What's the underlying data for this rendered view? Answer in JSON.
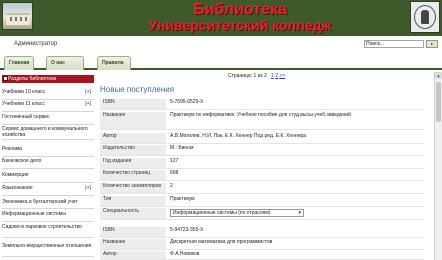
{
  "header": {
    "title_line1": "Библиотека",
    "title_line2": "Университетский колледж"
  },
  "user": {
    "name": "Администратор"
  },
  "search": {
    "label": "Поиск...",
    "button": ""
  },
  "nav": {
    "tabs": [
      {
        "label": "Главная"
      },
      {
        "label": "О нас"
      },
      {
        "label": "Правила"
      }
    ]
  },
  "sidebar": {
    "header": "Разделы библиотеки",
    "items": [
      {
        "label": "Учебники 10 класс",
        "expander": "[+]"
      },
      {
        "label": "Учебники 11 класс",
        "expander": "[+]"
      },
      {
        "label": "Гостиничный сервис",
        "expander": ""
      },
      {
        "label": "Сервис домашнего и коммунального хозяйства",
        "expander": ""
      },
      {
        "label": "Реклама",
        "expander": ""
      },
      {
        "label": "Банковское дело",
        "expander": ""
      },
      {
        "label": "Коммерция",
        "expander": ""
      },
      {
        "label": "Языкознание",
        "expander": "[+]"
      },
      {
        "label": "Экономика и бухгалтерский учет",
        "expander": ""
      },
      {
        "label": "Информационные системы",
        "expander": ""
      },
      {
        "label": "Садово-и парковое строительство",
        "expander": ""
      },
      {
        "label": "Земельно-имущественные отношения",
        "expander": ""
      }
    ]
  },
  "pager": {
    "text": "Страница: 1 из 2",
    "links": [
      "1",
      "2",
      ">>"
    ]
  },
  "main": {
    "section_title": "Новые поступления",
    "book1": {
      "isbn_label": "ISBN",
      "isbn": "5-7695-0529-X",
      "title_label": "Название",
      "title": "Практикум по информатике: Учебное пособие для студ.высш.учеб.заведений",
      "author_label": "Автор",
      "author": "А.В.Могилев, Н.И. Пак, Е.К. Хеннер Под ред. Е.К. Хеннера",
      "publisher_label": "Издательство",
      "publisher": "М.: Бином",
      "year_label": "Год издания",
      "year": "127",
      "pages_label": "Количество страниц",
      "pages": "608",
      "copies_label": "Количество экземпляров",
      "copies": "2",
      "type_label": "Тип",
      "type": "Практикум",
      "spec_label": "Специальность",
      "spec": "Информационные системы (по отраслям)"
    },
    "book2": {
      "isbn_label": "ISBN",
      "isbn": "5-94723-355-X",
      "title_label": "Название",
      "title": "Дискретная математика для программистов",
      "author_label": "Автор",
      "author": "Ф.А.Новиков"
    }
  }
}
